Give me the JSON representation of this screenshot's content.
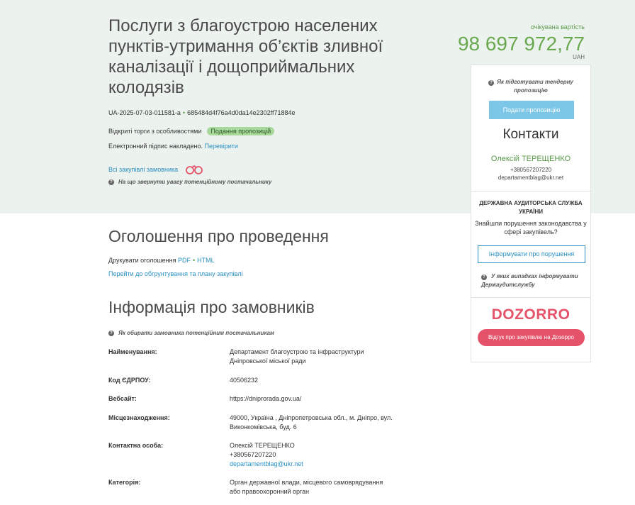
{
  "tender": {
    "title": "Послуги з благоустрою населених пунктів-утримання об’єктів зливної каналізації і дощоприймальних колодязів",
    "id": "UA-2025-07-03-011581-a",
    "hash": "685484d4f76a4d0da14e2302ff71884e",
    "procedure": "Відкриті торги з особливостями",
    "status": "Подання пропозицій",
    "signature_text": "Електронний підпис накладено.",
    "verify_link": "Перевірити",
    "all_purchases_link": "Всі закупівлі замовника",
    "attention_hint": "На що звернути увагу потенційному постачальнику"
  },
  "price": {
    "label": "очікувана вартість",
    "value": "98 697 972,77",
    "currency": "UAH"
  },
  "sidebar": {
    "prepare_hint": "Як підготувати тендерну пропозицію",
    "submit_button": "Подати пропозицію",
    "contacts_title": "Контакти",
    "contact_name": "Олексій ТЕРЕЩЕНКО",
    "contact_phone": "+380567207220",
    "contact_email": "departamentblag@ukr.net",
    "audit_title": "ДЕРЖАВНА АУДИТОРСЬКА СЛУЖБА УКРАЇНИ",
    "audit_question": "Знайшли порушення законодавства у сфері закупівель?",
    "audit_button": "Інформувати про порушення",
    "audit_hint": "У яких випадках інформувати Держаудитслужбу",
    "dozorro_logo": "DOZORRO",
    "dozorro_button": "Відгук про закупівлю на Дозорро"
  },
  "announcement": {
    "title": "Оголошення про проведення",
    "print_label": "Друкувати оголошення",
    "pdf": "PDF",
    "html": "HTML",
    "plan_link": "Перейти до обгрунтування та плану закупівлі"
  },
  "customer": {
    "title": "Інформація про замовників",
    "hint": "Як обирати замовника потенційним постачальникам",
    "rows": [
      {
        "label": "Найменування:",
        "value": "Департамент благоустрою та інфраструктури Дніпровської міської ради"
      },
      {
        "label": "Код ЄДРПОУ:",
        "value": "40506232"
      },
      {
        "label": "Вебсайт:",
        "value": "https://dniprorada.gov.ua/"
      },
      {
        "label": "Місцезнаходження:",
        "value": "49000, Україна , Дніпропетровська обл., м. Дніпро, вул. Виконкомівська, буд. 6"
      },
      {
        "label": "Контактна особа:",
        "value": "Олексій ТЕРЕЩЕНКО",
        "phone": "+380567207220",
        "email": "departamentblag@ukr.net"
      },
      {
        "label": "Категорія:",
        "value": "Орган державної влади, місцевого самоврядування або правоохоронний орган"
      }
    ]
  },
  "colors": {
    "hero_bg": "#ecf2ee",
    "accent_green": "#6aa84f",
    "link_blue": "#2a8fc1",
    "button_blue": "#7cc7e8",
    "dozorro_red": "#e5536a"
  }
}
